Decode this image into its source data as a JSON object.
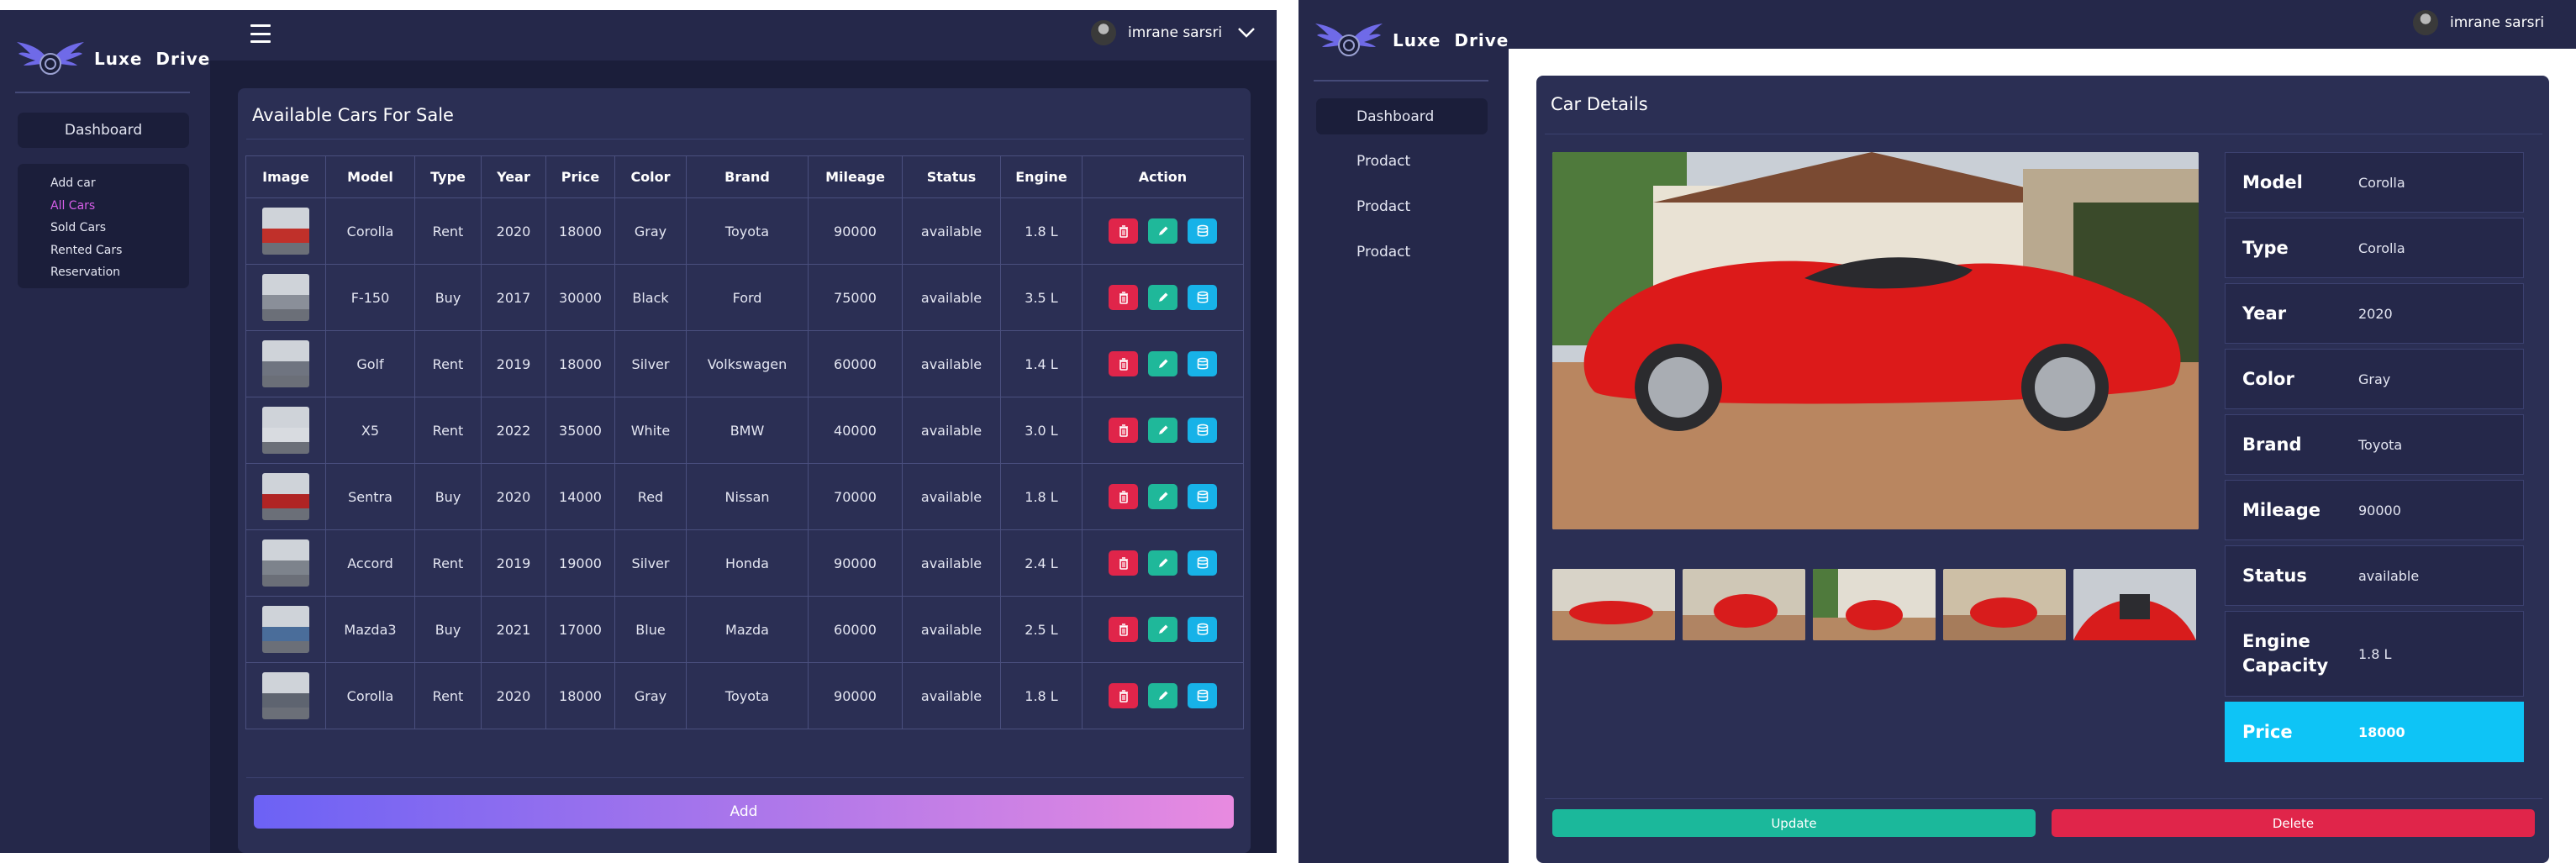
{
  "brand": {
    "name": "Luxe  Drive",
    "logo": "winged-wheel-logo"
  },
  "user": {
    "name": "imrane sarsri"
  },
  "colors": {
    "accent": "#6c62f5",
    "delete": "#e0254a",
    "edit": "#1fb89a",
    "database": "#17b2e8",
    "price_highlight": "#0ec4f6",
    "active_link": "#d65ee8"
  },
  "left": {
    "sidebar": {
      "dashboard_label": "Dashboard",
      "submenu": [
        {
          "label": "Add car",
          "active": false
        },
        {
          "label": "All Cars",
          "active": true
        },
        {
          "label": "Sold Cars",
          "active": false
        },
        {
          "label": "Rented Cars",
          "active": false
        },
        {
          "label": "Reservation",
          "active": false
        }
      ]
    },
    "main": {
      "title": "Available Cars For Sale",
      "columns": [
        "Image",
        "Model",
        "Type",
        "Year",
        "Price",
        "Color",
        "Brand",
        "Mileage",
        "Status",
        "Engine",
        "Action"
      ],
      "rows": [
        {
          "model": "Corolla",
          "type": "Rent",
          "year": "2020",
          "price": "18000",
          "color": "Gray",
          "brand": "Toyota",
          "mileage": "90000",
          "status": "available",
          "engine": "1.8 L"
        },
        {
          "model": "F-150",
          "type": "Buy",
          "year": "2017",
          "price": "30000",
          "color": "Black",
          "brand": "Ford",
          "mileage": "75000",
          "status": "available",
          "engine": "3.5 L"
        },
        {
          "model": "Golf",
          "type": "Rent",
          "year": "2019",
          "price": "18000",
          "color": "Silver",
          "brand": "Volkswagen",
          "mileage": "60000",
          "status": "available",
          "engine": "1.4 L"
        },
        {
          "model": "X5",
          "type": "Rent",
          "year": "2022",
          "price": "35000",
          "color": "White",
          "brand": "BMW",
          "mileage": "40000",
          "status": "available",
          "engine": "3.0 L"
        },
        {
          "model": "Sentra",
          "type": "Buy",
          "year": "2020",
          "price": "14000",
          "color": "Red",
          "brand": "Nissan",
          "mileage": "70000",
          "status": "available",
          "engine": "1.8 L"
        },
        {
          "model": "Accord",
          "type": "Rent",
          "year": "2019",
          "price": "19000",
          "color": "Silver",
          "brand": "Honda",
          "mileage": "90000",
          "status": "available",
          "engine": "2.4 L"
        },
        {
          "model": "Mazda3",
          "type": "Buy",
          "year": "2021",
          "price": "17000",
          "color": "Blue",
          "brand": "Mazda",
          "mileage": "60000",
          "status": "available",
          "engine": "2.5 L"
        },
        {
          "model": "Corolla",
          "type": "Rent",
          "year": "2020",
          "price": "18000",
          "color": "Gray",
          "brand": "Toyota",
          "mileage": "90000",
          "status": "available",
          "engine": "1.8 L"
        }
      ],
      "action_icons": [
        "trash-icon",
        "pencil-icon",
        "database-icon"
      ],
      "add_label": "Add"
    }
  },
  "right": {
    "sidebar": {
      "dashboard_label": "Dashboard",
      "items": [
        "Prodact",
        "Prodact",
        "Prodact"
      ]
    },
    "details": {
      "title": "Car Details",
      "specs": [
        {
          "label": "Model",
          "value": "Corolla"
        },
        {
          "label": "Type",
          "value": "Corolla"
        },
        {
          "label": "Year",
          "value": "2020"
        },
        {
          "label": "Color",
          "value": "Gray"
        },
        {
          "label": "Brand",
          "value": "Toyota"
        },
        {
          "label": "Mileage",
          "value": "90000"
        },
        {
          "label": "Status",
          "value": "available"
        },
        {
          "label": "Engine Capacity",
          "value": "1.8 L"
        },
        {
          "label": "Price",
          "value": "18000"
        }
      ],
      "update_label": "Update",
      "delete_label": "Delete"
    }
  }
}
